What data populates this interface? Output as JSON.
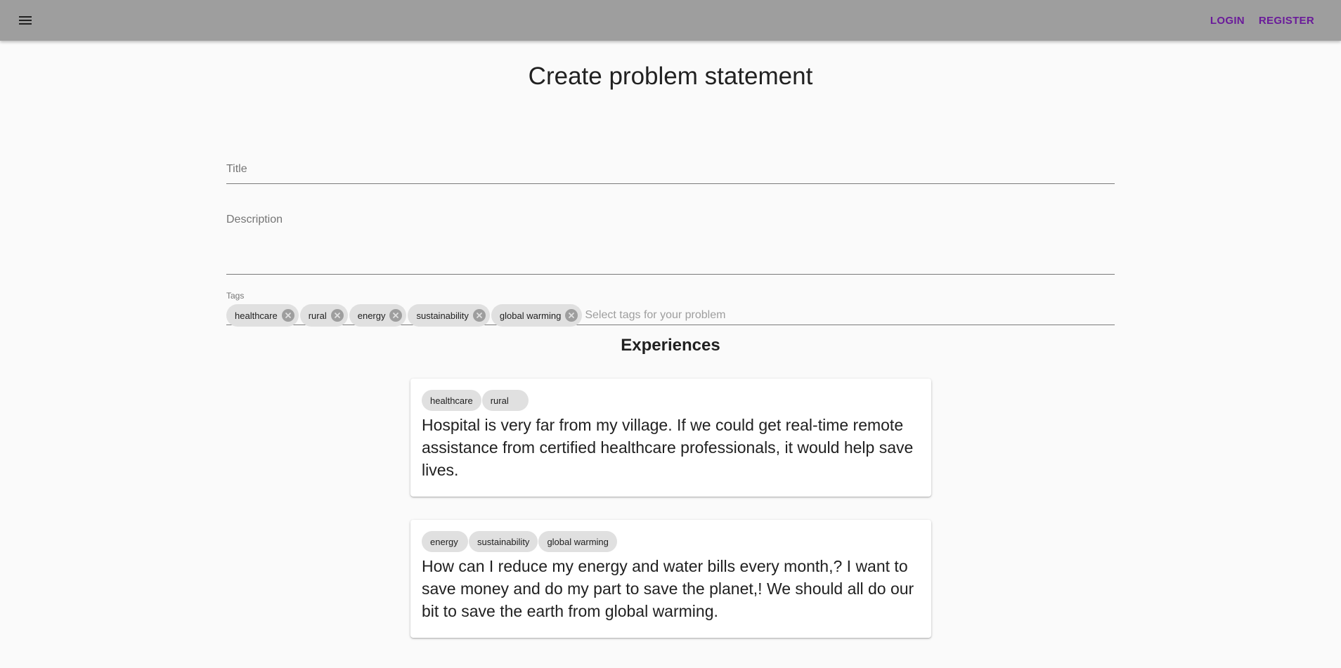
{
  "header": {
    "menu_icon": "hamburger-menu-icon",
    "login_label": "LOGIN",
    "register_label": "REGISTER",
    "accent_color": "#6a1b9a",
    "bar_color": "#9e9e9e"
  },
  "page": {
    "title": "Create problem statement"
  },
  "form": {
    "title_label": "Title",
    "title_value": "",
    "description_label": "Description",
    "description_value": "",
    "tags_label": "Tags",
    "tags": [
      "healthcare",
      "rural",
      "energy",
      "sustainability",
      "global warming"
    ],
    "tags_placeholder": "Select tags for your problem",
    "chip_delete_icon": "cancel-icon"
  },
  "experiences": {
    "title": "Experiences",
    "items": [
      {
        "tags": [
          "healthcare",
          "rural"
        ],
        "text": "Hospital is very far from my village. If we could get real-time remote assistance from certified healthcare professionals, it would help save lives."
      },
      {
        "tags": [
          "energy",
          "sustainability",
          "global warming"
        ],
        "text": "How can I reduce my energy and water bills every month,? I want to save money and do my part to save the planet,! We should all do our bit to save the earth from global warming."
      }
    ]
  }
}
